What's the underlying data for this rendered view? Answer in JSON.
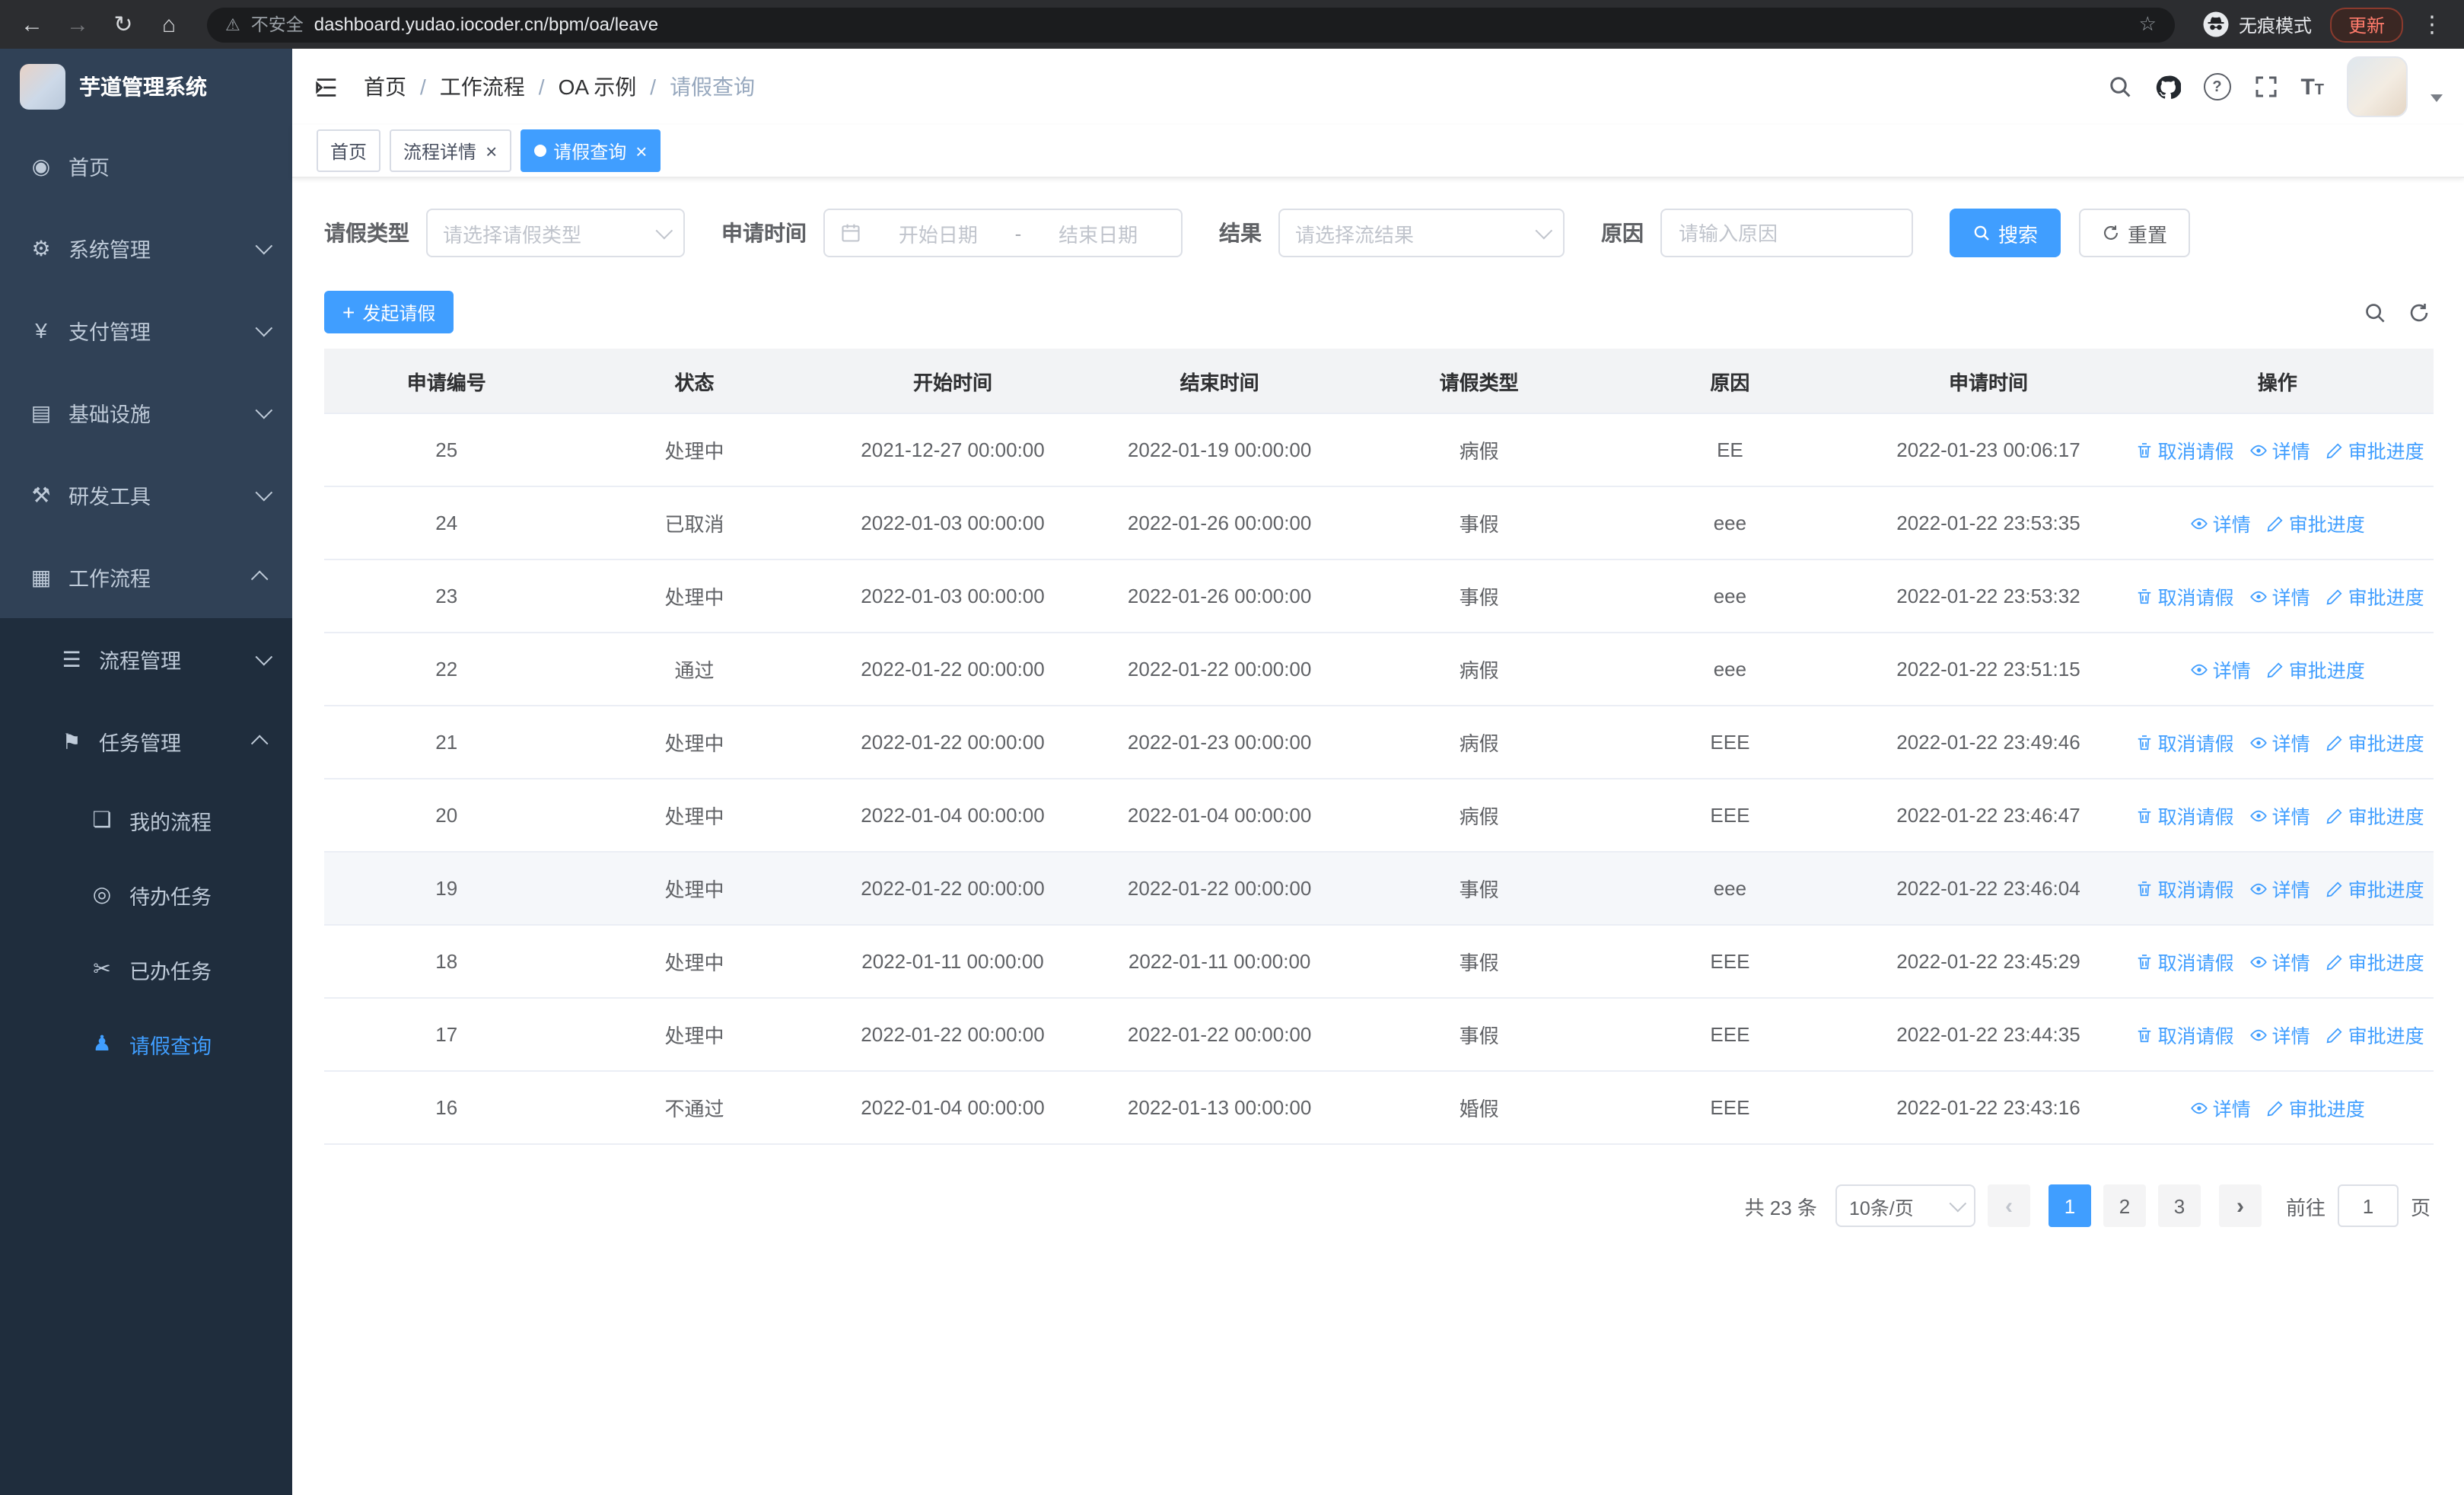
{
  "colors": {
    "primary": "#409eff",
    "sidebar_bg": "#304156",
    "sidebar_sub_bg": "#1f2d3d"
  },
  "browser": {
    "security_label": "不安全",
    "url": "dashboard.yudao.iocoder.cn/bpm/oa/leave",
    "incognito_label": "无痕模式",
    "update_label": "更新"
  },
  "sidebar": {
    "title": "芋道管理系统",
    "menu": [
      {
        "name": "home",
        "label": "首页",
        "icon": "dashboard-icon",
        "glyph": "◉",
        "level": 1
      },
      {
        "name": "system",
        "label": "系统管理",
        "icon": "gear-icon",
        "glyph": "⚙",
        "level": 1,
        "arrow": "down"
      },
      {
        "name": "payment",
        "label": "支付管理",
        "icon": "payment-icon",
        "glyph": "¥",
        "level": 1,
        "arrow": "down"
      },
      {
        "name": "infrastructure",
        "label": "基础设施",
        "icon": "infrastructure-icon",
        "glyph": "▤",
        "level": 1,
        "arrow": "down"
      },
      {
        "name": "devtools",
        "label": "研发工具",
        "icon": "tools-icon",
        "glyph": "⚒",
        "level": 1,
        "arrow": "down"
      },
      {
        "name": "workflow",
        "label": "工作流程",
        "icon": "briefcase-icon",
        "glyph": "▦",
        "level": 1,
        "arrow": "up"
      },
      {
        "name": "process-mgmt",
        "label": "流程管理",
        "icon": "list-icon",
        "glyph": "☰",
        "level": 2,
        "arrow": "down"
      },
      {
        "name": "task-mgmt",
        "label": "任务管理",
        "icon": "flag-icon",
        "glyph": "⚑",
        "level": 2,
        "arrow": "up"
      },
      {
        "name": "my-process",
        "label": "我的流程",
        "icon": "chat-icon",
        "glyph": "❏",
        "level": 3
      },
      {
        "name": "todo-task",
        "label": "待办任务",
        "icon": "eye-icon",
        "glyph": "◎",
        "level": 3
      },
      {
        "name": "done-task",
        "label": "已办任务",
        "icon": "scissors-icon",
        "glyph": "✂",
        "level": 3
      },
      {
        "name": "leave-query",
        "label": "请假查询",
        "icon": "person-icon",
        "glyph": "♟",
        "level": 3,
        "active": true
      }
    ]
  },
  "navbar": {
    "breadcrumb": [
      {
        "label": "首页"
      },
      {
        "label": "工作流程"
      },
      {
        "label": "OA 示例"
      },
      {
        "label": "请假查询",
        "current": true
      }
    ]
  },
  "tabs": [
    {
      "label": "首页",
      "closable": false,
      "active": false
    },
    {
      "label": "流程详情",
      "closable": true,
      "active": false
    },
    {
      "label": "请假查询",
      "closable": true,
      "active": true
    }
  ],
  "filters": {
    "leave_type": {
      "label": "请假类型",
      "placeholder": "请选择请假类型"
    },
    "apply_time": {
      "label": "申请时间",
      "start_placeholder": "开始日期",
      "separator": "-",
      "end_placeholder": "结束日期"
    },
    "result": {
      "label": "结果",
      "placeholder": "请选择流结果"
    },
    "reason": {
      "label": "原因",
      "placeholder": "请输入原因"
    },
    "search_label": "搜索",
    "reset_label": "重置"
  },
  "toolbar": {
    "create_label": "发起请假"
  },
  "table": {
    "columns": [
      "申请编号",
      "状态",
      "开始时间",
      "结束时间",
      "请假类型",
      "原因",
      "申请时间",
      "操作"
    ],
    "action_labels": {
      "cancel": "取消请假",
      "detail": "详情",
      "progress": "审批进度"
    },
    "rows": [
      {
        "id": "25",
        "status": "处理中",
        "start_time": "2021-12-27 00:00:00",
        "end_time": "2022-01-19 00:00:00",
        "leave_type": "病假",
        "reason": "EE",
        "apply_time": "2022-01-23 00:06:17",
        "actions": [
          "cancel",
          "detail",
          "progress"
        ],
        "highlighted": false
      },
      {
        "id": "24",
        "status": "已取消",
        "start_time": "2022-01-03 00:00:00",
        "end_time": "2022-01-26 00:00:00",
        "leave_type": "事假",
        "reason": "eee",
        "apply_time": "2022-01-22 23:53:35",
        "actions": [
          "detail",
          "progress"
        ],
        "highlighted": false
      },
      {
        "id": "23",
        "status": "处理中",
        "start_time": "2022-01-03 00:00:00",
        "end_time": "2022-01-26 00:00:00",
        "leave_type": "事假",
        "reason": "eee",
        "apply_time": "2022-01-22 23:53:32",
        "actions": [
          "cancel",
          "detail",
          "progress"
        ],
        "highlighted": false
      },
      {
        "id": "22",
        "status": "通过",
        "start_time": "2022-01-22 00:00:00",
        "end_time": "2022-01-22 00:00:00",
        "leave_type": "病假",
        "reason": "eee",
        "apply_time": "2022-01-22 23:51:15",
        "actions": [
          "detail",
          "progress"
        ],
        "highlighted": false
      },
      {
        "id": "21",
        "status": "处理中",
        "start_time": "2022-01-22 00:00:00",
        "end_time": "2022-01-23 00:00:00",
        "leave_type": "病假",
        "reason": "EEE",
        "apply_time": "2022-01-22 23:49:46",
        "actions": [
          "cancel",
          "detail",
          "progress"
        ],
        "highlighted": false
      },
      {
        "id": "20",
        "status": "处理中",
        "start_time": "2022-01-04 00:00:00",
        "end_time": "2022-01-04 00:00:00",
        "leave_type": "病假",
        "reason": "EEE",
        "apply_time": "2022-01-22 23:46:47",
        "actions": [
          "cancel",
          "detail",
          "progress"
        ],
        "highlighted": false
      },
      {
        "id": "19",
        "status": "处理中",
        "start_time": "2022-01-22 00:00:00",
        "end_time": "2022-01-22 00:00:00",
        "leave_type": "事假",
        "reason": "eee",
        "apply_time": "2022-01-22 23:46:04",
        "actions": [
          "cancel",
          "detail",
          "progress"
        ],
        "highlighted": true
      },
      {
        "id": "18",
        "status": "处理中",
        "start_time": "2022-01-11 00:00:00",
        "end_time": "2022-01-11 00:00:00",
        "leave_type": "事假",
        "reason": "EEE",
        "apply_time": "2022-01-22 23:45:29",
        "actions": [
          "cancel",
          "detail",
          "progress"
        ],
        "highlighted": false
      },
      {
        "id": "17",
        "status": "处理中",
        "start_time": "2022-01-22 00:00:00",
        "end_time": "2022-01-22 00:00:00",
        "leave_type": "事假",
        "reason": "EEE",
        "apply_time": "2022-01-22 23:44:35",
        "actions": [
          "cancel",
          "detail",
          "progress"
        ],
        "highlighted": false
      },
      {
        "id": "16",
        "status": "不通过",
        "start_time": "2022-01-04 00:00:00",
        "end_time": "2022-01-13 00:00:00",
        "leave_type": "婚假",
        "reason": "EEE",
        "apply_time": "2022-01-22 23:43:16",
        "actions": [
          "detail",
          "progress"
        ],
        "highlighted": false
      }
    ]
  },
  "pagination": {
    "total_label": "共 23 条",
    "page_size_label": "10条/页",
    "pages": [
      "1",
      "2",
      "3"
    ],
    "active_page": "1",
    "goto_label": "前往",
    "goto_value": "1",
    "unit_label": "页"
  }
}
